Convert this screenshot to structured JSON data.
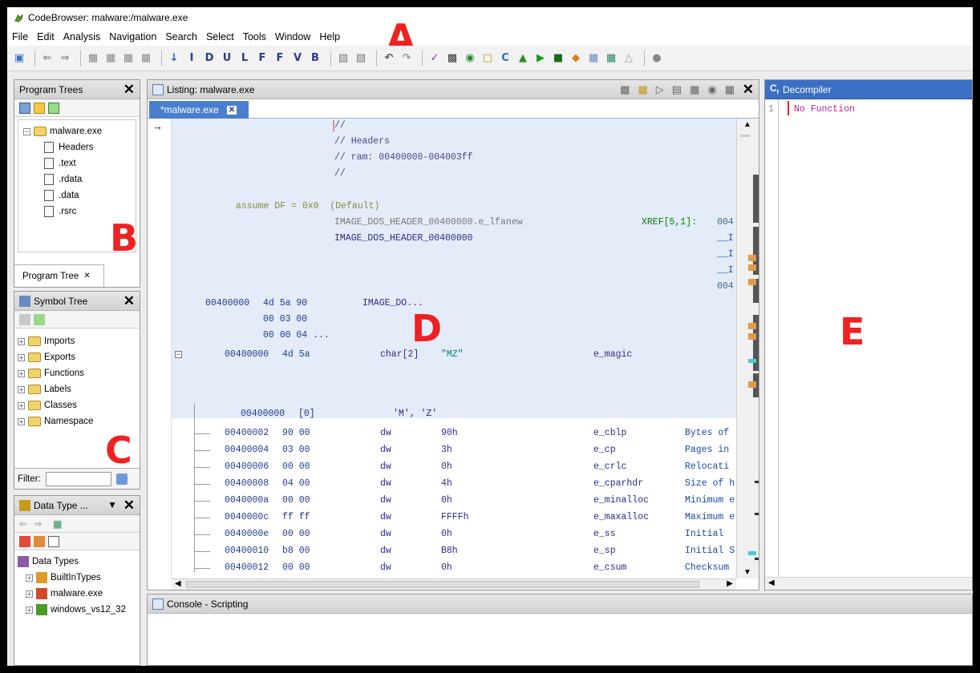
{
  "window": {
    "title": "CodeBrowser: malware:/malware.exe"
  },
  "menu": [
    "File",
    "Edit",
    "Analysis",
    "Navigation",
    "Search",
    "Select",
    "Tools",
    "Window",
    "Help"
  ],
  "annotations": {
    "a": "A",
    "b": "B",
    "c": "C",
    "d": "D",
    "e": "E"
  },
  "program_trees": {
    "title": "Program Trees",
    "root": "malware.exe",
    "items": [
      "Headers",
      ".text",
      ".rdata",
      ".data",
      ".rsrc"
    ],
    "tab": "Program Tree"
  },
  "symbol_tree": {
    "title": "Symbol Tree",
    "items": [
      "Imports",
      "Exports",
      "Functions",
      "Labels",
      "Classes",
      "Namespace"
    ],
    "filter_label": "Filter:"
  },
  "data_types": {
    "title": "Data Type ...",
    "root": "Data Types",
    "items": [
      "BuiltInTypes",
      "malware.exe",
      "windows_vs12_32"
    ]
  },
  "listing": {
    "title": "Listing:  malware.exe",
    "tab": "*malware.exe",
    "header_comments": [
      "//",
      "// Headers",
      "// ram: 00400000-004003ff",
      "//"
    ],
    "assume": "assume DF = 0x0  (Default)",
    "label1": "IMAGE_DOS_HEADER_00400000.e_lfanew",
    "xref": "XREF[5,1]:",
    "xref_val": "004",
    "label2": "IMAGE_DOS_HEADER_00400000",
    "xref_items": [
      "__I",
      "__I",
      "__I",
      "004"
    ],
    "struct_addr": "00400000",
    "struct_bytes": [
      "4d 5a 90",
      "00 03 00",
      "00 00 04 ..."
    ],
    "struct_name": "IMAGE_DO...",
    "magic": {
      "addr": "00400000",
      "bytes": "4d 5a",
      "type": "char[2]",
      "value": "\"MZ\"",
      "field": "e_magic"
    },
    "magic_elem": {
      "addr": "00400000",
      "index": "[0]",
      "value": "'M', 'Z'"
    },
    "rows": [
      {
        "addr": "00400002",
        "bytes": "90 00",
        "mn": "dw",
        "val": "90h",
        "field": "e_cblp",
        "cmt": "Bytes of"
      },
      {
        "addr": "00400004",
        "bytes": "03 00",
        "mn": "dw",
        "val": "3h",
        "field": "e_cp",
        "cmt": "Pages in"
      },
      {
        "addr": "00400006",
        "bytes": "00 00",
        "mn": "dw",
        "val": "0h",
        "field": "e_crlc",
        "cmt": "Relocati"
      },
      {
        "addr": "00400008",
        "bytes": "04 00",
        "mn": "dw",
        "val": "4h",
        "field": "e_cparhdr",
        "cmt": "Size of h"
      },
      {
        "addr": "0040000a",
        "bytes": "00 00",
        "mn": "dw",
        "val": "0h",
        "field": "e_minalloc",
        "cmt": "Minimum e"
      },
      {
        "addr": "0040000c",
        "bytes": "ff ff",
        "mn": "dw",
        "val": "FFFFh",
        "field": "e_maxalloc",
        "cmt": "Maximum e"
      },
      {
        "addr": "0040000e",
        "bytes": "00 00",
        "mn": "dw",
        "val": "0h",
        "field": "e_ss",
        "cmt": "Initial"
      },
      {
        "addr": "00400010",
        "bytes": "b8 00",
        "mn": "dw",
        "val": "B8h",
        "field": "e_sp",
        "cmt": "Initial S"
      },
      {
        "addr": "00400012",
        "bytes": "00 00",
        "mn": "dw",
        "val": "0h",
        "field": "e_csum",
        "cmt": "Checksum"
      }
    ]
  },
  "decompiler": {
    "title": "Decompiler",
    "line_no": "1",
    "text": "No Function"
  },
  "console": {
    "title": "Console - Scripting"
  },
  "colors": {
    "accent": "#3b6fc4",
    "selection": "#e3ecf8",
    "annotation": "#e22222"
  }
}
